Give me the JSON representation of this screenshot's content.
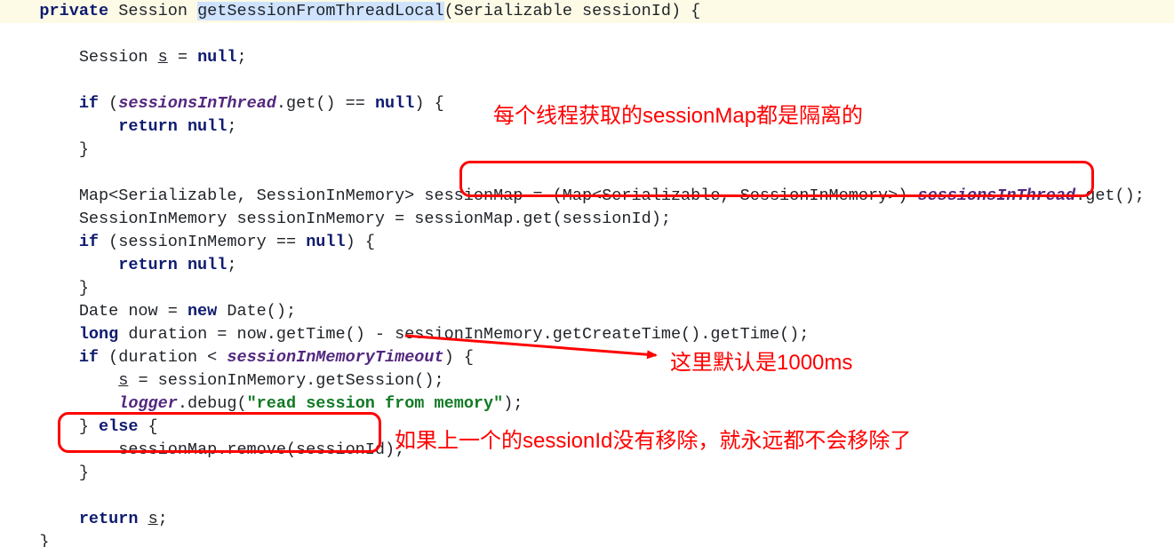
{
  "code": {
    "lines": [
      {
        "cls": "hl-line",
        "html": "    <span class='kw'>private</span> Session <span class='sel'>getSessionFromThreadLocal</span>(Serializable sessionId) {"
      },
      {
        "html": "        Session <span class='ul'>s</span> = <span class='kw'>null</span>;"
      },
      {
        "html": ""
      },
      {
        "html": "        <span class='kw'>if</span> (<span class='field'>sessionsInThread</span>.get() == <span class='kw'>null</span>) {"
      },
      {
        "html": "            <span class='kw'>return null</span>;"
      },
      {
        "html": "        }"
      },
      {
        "html": ""
      },
      {
        "html": "        Map&lt;Serializable, SessionInMemory&gt; sessionMap = (Map&lt;Serializable, SessionInMemory&gt;) <span class='field'>sessionsInThread</span>.get();"
      },
      {
        "html": "        SessionInMemory sessionInMemory = sessionMap.get(sessionId);"
      },
      {
        "html": "        <span class='kw'>if</span> (sessionInMemory == <span class='kw'>null</span>) {"
      },
      {
        "html": "            <span class='kw'>return null</span>;"
      },
      {
        "html": "        }"
      },
      {
        "html": "        Date now = <span class='kw'>new</span> Date();"
      },
      {
        "html": "        <span class='kw'>long</span> duration = now.getTime() - sessionInMemory.getCreateTime().getTime();"
      },
      {
        "html": "        <span class='kw'>if</span> (duration &lt; <span class='field'>sessionInMemoryTimeout</span>) {"
      },
      {
        "html": "            <span class='ul'>s</span> = sessionInMemory.getSession();"
      },
      {
        "html": "            <span class='field'>logger</span>.debug(<span class='str'>&quot;read session from memory&quot;</span>);"
      },
      {
        "html": "        } <span class='kw'>else</span> {"
      },
      {
        "html": "            sessionMap.remove(sessionId);"
      },
      {
        "html": "        }"
      },
      {
        "html": ""
      },
      {
        "html": "        <span class='kw'>return</span> <span class='ul'>s</span>;"
      },
      {
        "html": "    }"
      }
    ]
  },
  "annotations": {
    "a1": "每个线程获取的sessionMap都是隔离的",
    "a2": "这里默认是1000ms",
    "a3": "如果上一个的sessionId没有移除，就永远都不会移除了"
  }
}
